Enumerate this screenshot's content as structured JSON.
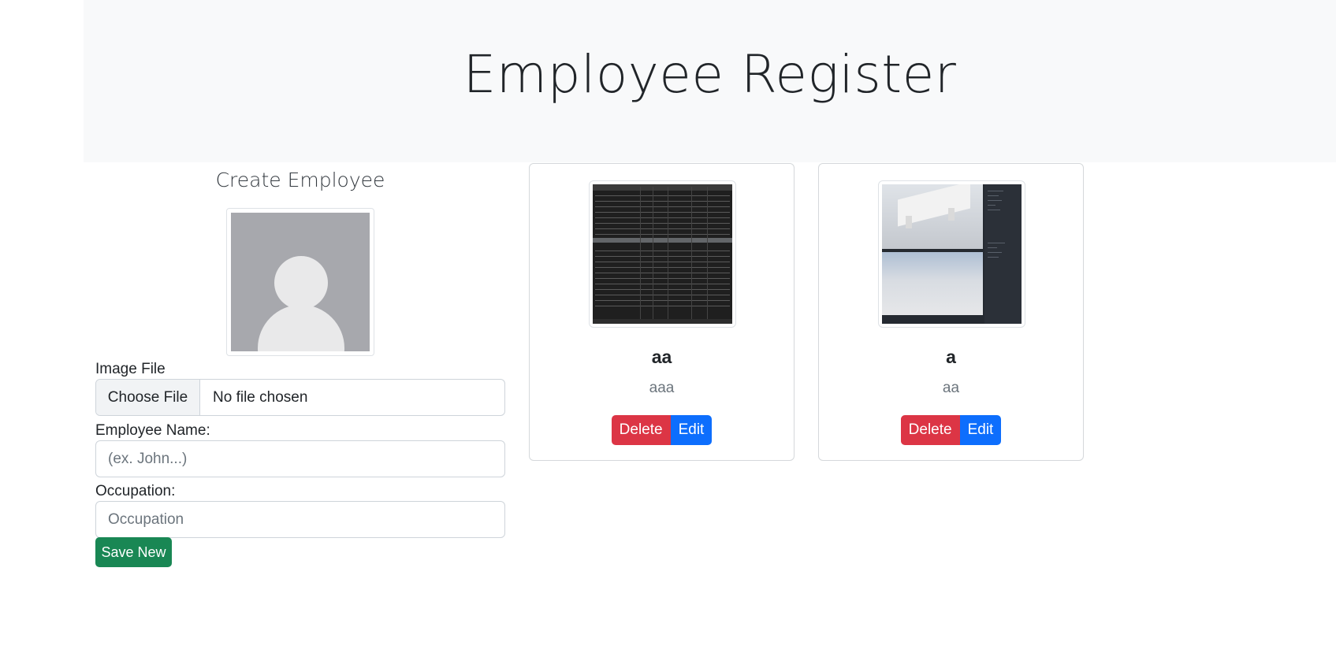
{
  "header": {
    "title": "Employee Register"
  },
  "form": {
    "title": "Create Employee",
    "image_label": "Image File",
    "choose_file": "Choose File",
    "file_status": "No file chosen",
    "name_label": "Employee Name:",
    "name_placeholder": "(ex. John...)",
    "occupation_label": "Occupation:",
    "occupation_placeholder": "Occupation",
    "save_label": "Save New"
  },
  "employees": [
    {
      "name": "aa",
      "occupation": "aaa",
      "delete_label": "Delete",
      "edit_label": "Edit"
    },
    {
      "name": "a",
      "occupation": "aa",
      "delete_label": "Delete",
      "edit_label": "Edit"
    }
  ],
  "colors": {
    "danger": "#dc3545",
    "primary": "#0d6efd",
    "success": "#198754",
    "jumbotron": "#f8f9fa"
  }
}
